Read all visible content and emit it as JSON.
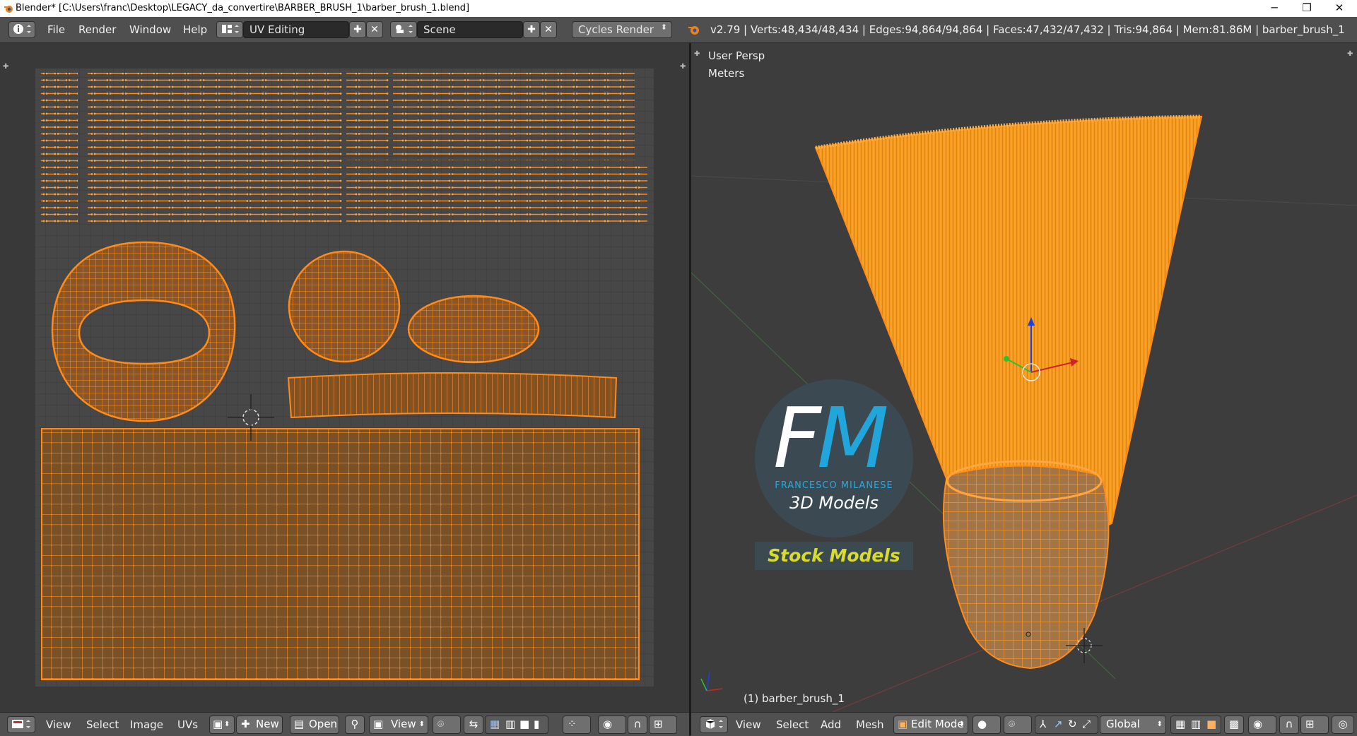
{
  "window": {
    "title": "Blender* [C:\\Users\\franc\\Desktop\\LEGACY_da_convertire\\BARBER_BRUSH_1\\barber_brush_1.blend]",
    "minimize": "─",
    "maximize": "❐",
    "close": "✕"
  },
  "menubar": {
    "menus": [
      "File",
      "Render",
      "Window",
      "Help"
    ],
    "screen_layout": "UV Editing",
    "scene": "Scene",
    "render_engine": "Cycles Render",
    "stats": "v2.79 | Verts:48,434/48,434 | Edges:94,864/94,864 | Faces:47,432/47,432 | Tris:94,864 | Mem:81.86M | barber_brush_1"
  },
  "uv_editor": {
    "header": {
      "menus": [
        "View",
        "Select",
        "Image",
        "UVs"
      ],
      "new_label": "New",
      "open_label": "Open",
      "view_label": "View"
    }
  },
  "viewport": {
    "view_label": "User Persp",
    "units_label": "Meters",
    "object_label": "(1) barber_brush_1",
    "header": {
      "menus": [
        "View",
        "Select",
        "Add",
        "Mesh"
      ],
      "mode": "Edit Mode",
      "orientation": "Global"
    },
    "watermark": {
      "f": "F",
      "m": "M",
      "name": "FRANCESCO MILANESE",
      "tagline": "3D Models",
      "badge": "Stock Models"
    }
  },
  "colors": {
    "wire": "#ff8c1a",
    "face": "#c8741f",
    "brand_blue": "#21a6dc",
    "brand_yellow": "#d9dc2f"
  }
}
